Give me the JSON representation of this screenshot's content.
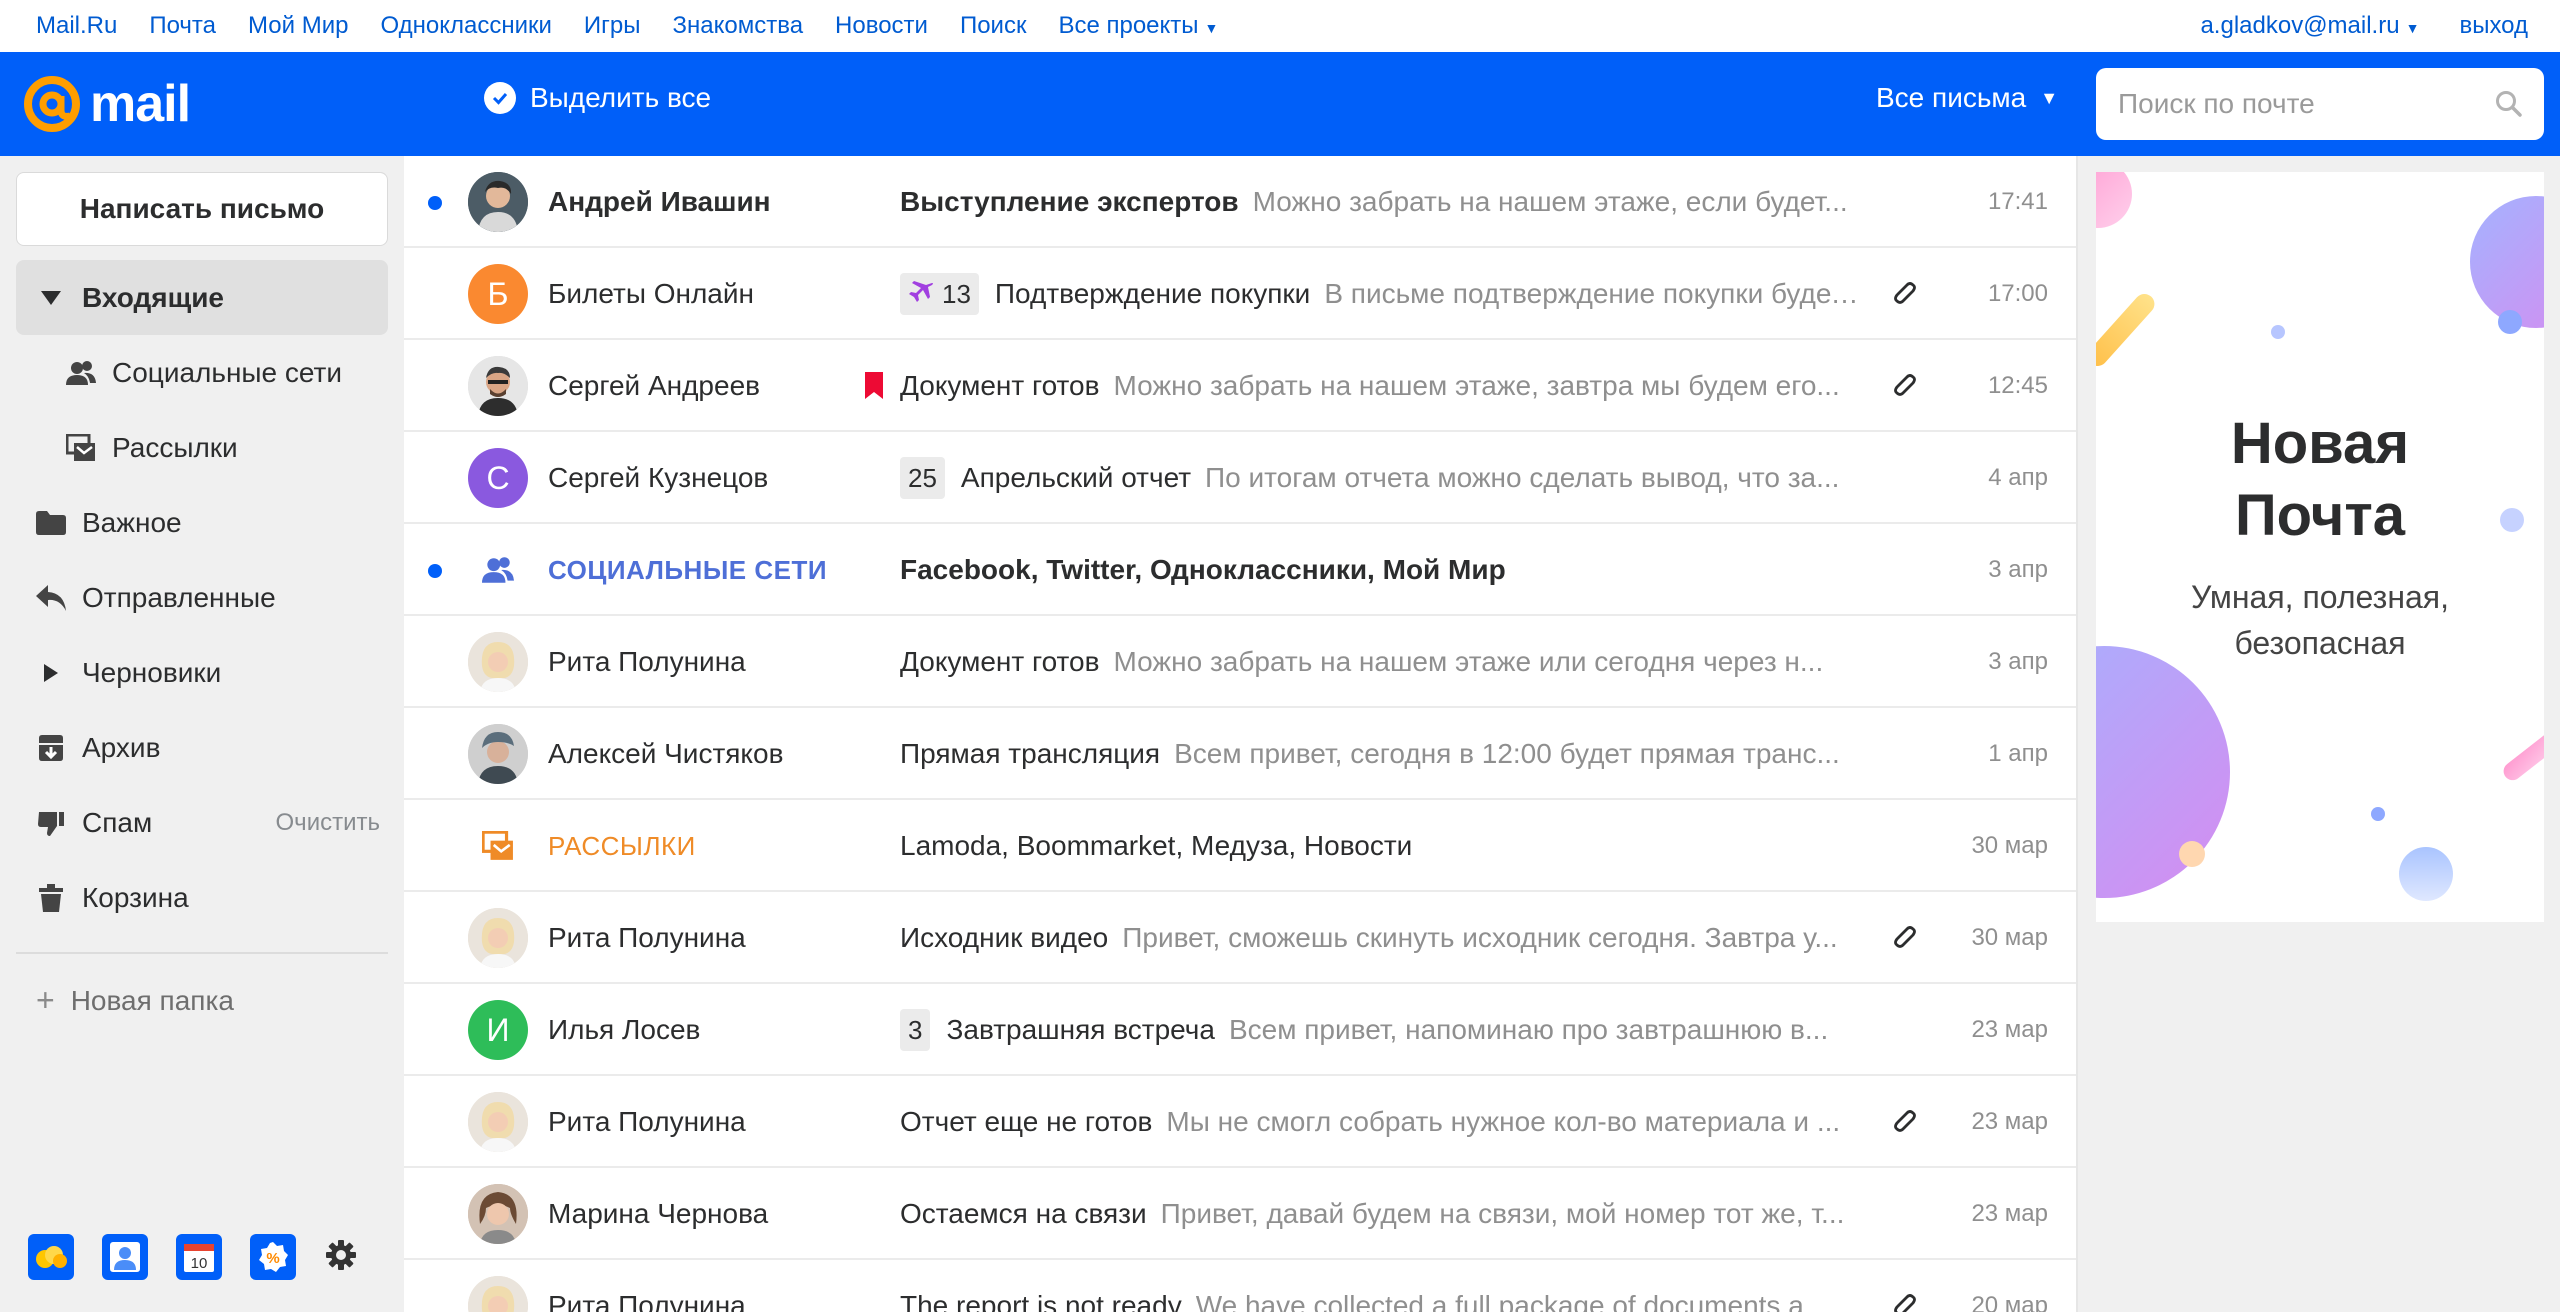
{
  "portal": {
    "links": [
      "Mail.Ru",
      "Почта",
      "Мой Мир",
      "Одноклассники",
      "Игры",
      "Знакомства",
      "Новости",
      "Поиск",
      "Все проекты"
    ],
    "user": "a.gladkov@mail.ru",
    "logout": "выход"
  },
  "header": {
    "logo": "mail",
    "select_all": "Выделить все",
    "filter": "Все письма",
    "search_placeholder": "Поиск по почте"
  },
  "sidebar": {
    "compose": "Написать письмо",
    "folders": [
      {
        "label": "Входящие",
        "icon": "triangle-down-icon"
      },
      {
        "label": "Социальные сети",
        "icon": "people-icon"
      },
      {
        "label": "Рассылки",
        "icon": "newsletter-icon"
      },
      {
        "label": "Важное",
        "icon": "folder-icon"
      },
      {
        "label": "Отправленные",
        "icon": "reply-icon"
      },
      {
        "label": "Черновики",
        "icon": "triangle-right-icon"
      },
      {
        "label": "Архив",
        "icon": "archive-icon"
      },
      {
        "label": "Спам",
        "icon": "thumbs-down-icon"
      },
      {
        "label": "Корзина",
        "icon": "trash-icon"
      }
    ],
    "spam_clear": "Очистить",
    "new_folder": "Новая папка"
  },
  "messages": [
    {
      "sender": "Андрей Ивашин",
      "subject": "Выступление экспертов",
      "snippet": "Можно забрать на нашем этаже, если будет...",
      "time": "17:41",
      "unread": true
    },
    {
      "sender": "Билеты Онлайн",
      "avatar_letter": "Б",
      "badge": "13",
      "subject": "Подтверждение покупки",
      "snippet": "В письме подтверждение покупки будет...",
      "time": "17:00",
      "attachment": true
    },
    {
      "sender": "Сергей Андреев",
      "subject": "Документ готов",
      "snippet": "Можно забрать на нашем этаже, завтра мы будем его...",
      "time": "12:45",
      "attachment": true,
      "flag": true
    },
    {
      "sender": "Сергей Кузнецов",
      "avatar_letter": "С",
      "badge": "25",
      "subject": "Апрельский отчет",
      "snippet": "По итогам отчета можно сделать вывод, что за...",
      "time": "4 апр"
    },
    {
      "sender": "СОЦИАЛЬНЫЕ СЕТИ",
      "subject": "Facebook, Twitter, Одноклассники, Мой Мир",
      "snippet": "",
      "time": "3 апр",
      "unread": true
    },
    {
      "sender": "Рита Полунина",
      "subject": "Документ готов",
      "snippet": "Можно забрать на нашем этаже или сегодня через н...",
      "time": "3 апр"
    },
    {
      "sender": "Алексей Чистяков",
      "subject": "Прямая трансляция",
      "snippet": "Всем привет, сегодня в 12:00 будет прямая транс...",
      "time": "1 апр"
    },
    {
      "sender": "РАССЫЛКИ",
      "subject": "Lamoda, Boommarket, Медуза, Новости",
      "snippet": "",
      "time": "30 мар"
    },
    {
      "sender": "Рита Полунина",
      "subject": "Исходник видео",
      "snippet": "Привет, сможешь скинуть исходник сегодня. Завтра у...",
      "time": "30 мар",
      "attachment": true
    },
    {
      "sender": "Илья Лосев",
      "avatar_letter": "И",
      "badge": "3",
      "subject": "Завтрашняя встреча",
      "snippet": "Всем привет, напоминаю про завтрашнюю в...",
      "time": "23 мар"
    },
    {
      "sender": "Рита Полунина",
      "subject": "Отчет еще не готов",
      "snippet": "Мы не смогл собрать нужное кол-во материала и ...",
      "time": "23 мар",
      "attachment": true
    },
    {
      "sender": "Марина Чернова",
      "subject": "Остаемся на связи",
      "snippet": "Привет, давай будем на связи, мой номер тот же, т...",
      "time": "23 мар"
    },
    {
      "sender": "Рита Полунина",
      "subject": "The report is not ready",
      "snippet": "We have collected a full package of documents a...",
      "time": "20 мар",
      "attachment": true
    }
  ],
  "ad": {
    "title_line1": "Новая",
    "title_line2": "Почта",
    "subtitle_line1": "Умная, полезная,",
    "subtitle_line2": "безопасная"
  },
  "colors": {
    "brand_blue": "#005ff9",
    "link_blue": "#005bd1",
    "social": "#4e6fd7",
    "newsletter": "#ef8b27"
  }
}
